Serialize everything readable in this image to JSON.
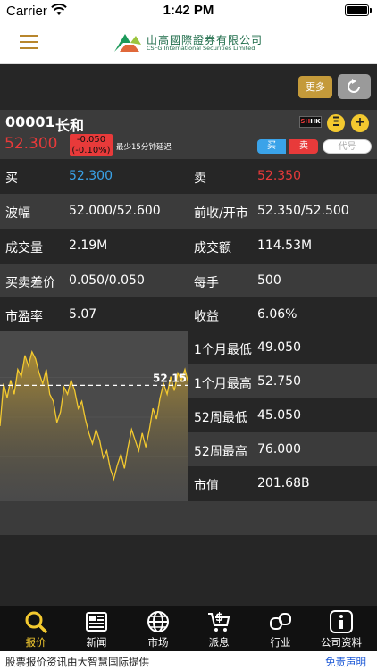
{
  "status_bar": {
    "carrier": "Carrier",
    "time": "1:42 PM"
  },
  "header": {
    "logo_cn": "山高國際證券有限公司",
    "logo_en": "CSFG International Securities Limited"
  },
  "toolbar": {
    "more_label": "更多"
  },
  "stock": {
    "code": "00001",
    "name": "长和",
    "price": "52.300",
    "change": "-0.050",
    "change_pct": "(-0.10%)",
    "delay_note": "最少15分钟延迟",
    "market_badge_sh": "SH",
    "market_badge_hk": "HK",
    "list_btn": "Ξ",
    "add_btn": "+",
    "buy_label": "买",
    "sell_label": "卖",
    "code_placeholder": "代号"
  },
  "quote_rows": [
    {
      "l1": "买",
      "v1": "52.300",
      "l2": "卖",
      "v2": "52.350"
    },
    {
      "l1": "波幅",
      "v1": "52.000/52.600",
      "l2": "前收/开市",
      "v2": "52.350/52.500"
    },
    {
      "l1": "成交量",
      "v1": "2.19M",
      "l2": "成交额",
      "v2": "114.53M"
    },
    {
      "l1": "买卖差价",
      "v1": "0.050/0.050",
      "l2": "每手",
      "v2": "500"
    },
    {
      "l1": "市盈率",
      "v1": "5.07",
      "l2": "收益",
      "v2": "6.06%"
    }
  ],
  "stats": [
    {
      "label": "1个月最低",
      "value": "49.050"
    },
    {
      "label": "1个月最高",
      "value": "52.750"
    },
    {
      "label": "52周最低",
      "value": "45.050"
    },
    {
      "label": "52周最高",
      "value": "76.000"
    },
    {
      "label": "市值",
      "value": "201.68B"
    }
  ],
  "chart_data": {
    "type": "area",
    "current_label": "52.15",
    "reference_value": 52.15,
    "ylim": [
      49.0,
      53.5
    ],
    "values": [
      51.0,
      52.2,
      51.8,
      52.3,
      51.9,
      52.6,
      52.4,
      53.0,
      52.7,
      53.1,
      52.9,
      52.5,
      52.2,
      52.6,
      51.9,
      51.7,
      51.1,
      51.4,
      52.1,
      51.9,
      52.3,
      52.0,
      51.5,
      51.7,
      51.2,
      50.8,
      50.5,
      50.9,
      50.6,
      50.1,
      50.3,
      49.8,
      49.5,
      49.9,
      50.2,
      49.8,
      50.4,
      50.9,
      50.6,
      50.3,
      50.8,
      50.4,
      50.9,
      51.5,
      51.2,
      51.8,
      52.2,
      51.9,
      52.4,
      52.0,
      52.5,
      52.3,
      52.6,
      52.2
    ]
  },
  "colors": {
    "gold": "#f3c92f",
    "red": "#e83a3a",
    "blue": "#3aa3e9",
    "chart_line": "#f3c92f"
  },
  "tabs": [
    {
      "label": "报价",
      "icon": "search-icon",
      "active": true
    },
    {
      "label": "新闻",
      "icon": "newspaper-icon",
      "active": false
    },
    {
      "label": "市场",
      "icon": "globe-icon",
      "active": false
    },
    {
      "label": "派息",
      "icon": "dollar-cart-icon",
      "active": false
    },
    {
      "label": "行业",
      "icon": "industry-icon",
      "active": false
    },
    {
      "label": "公司资料",
      "icon": "info-icon",
      "active": false
    }
  ],
  "footer": {
    "text": "股票报价资讯由大智慧国际提供",
    "disclaimer": "免责声明"
  }
}
